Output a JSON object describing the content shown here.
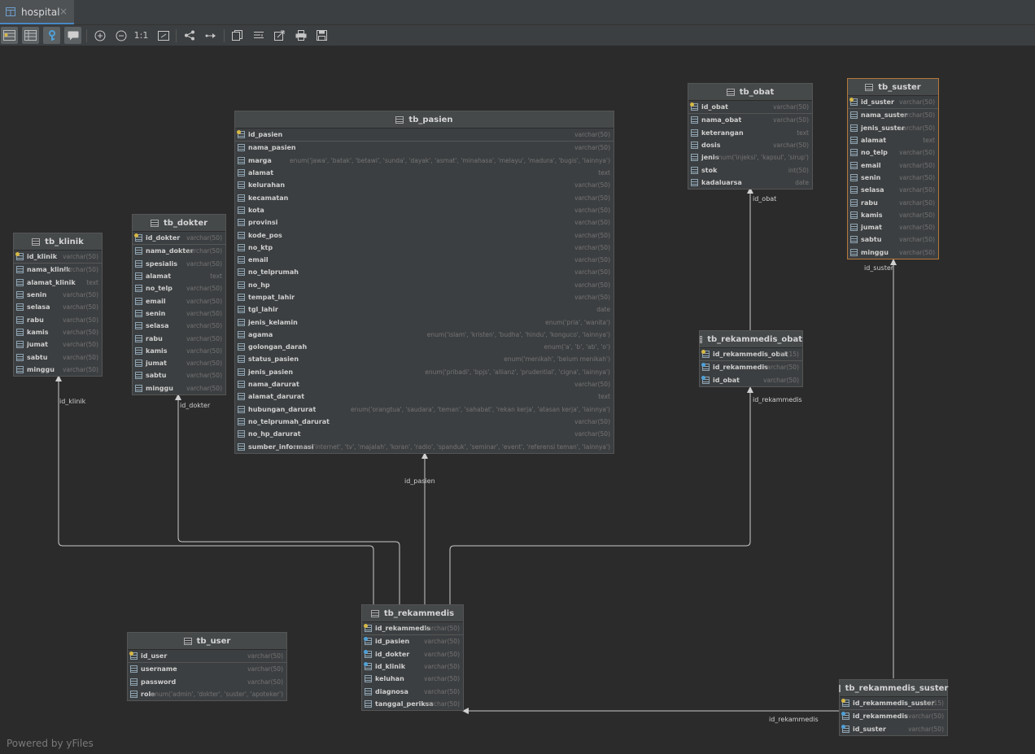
{
  "tab": {
    "title": "hospital",
    "close": "×"
  },
  "toolbar": {
    "actual_size": "1:1"
  },
  "footer": "Powered by yFiles",
  "links": {
    "id_klinik": "id_klinik",
    "id_dokter": "id_dokter",
    "id_pasien": "id_pasien",
    "id_obat": "id_obat",
    "id_suster": "id_suster",
    "id_rekammedis_1": "id_rekammedis",
    "id_rekammedis_2": "id_rekammedis"
  },
  "tables": {
    "tb_klinik": {
      "name": "tb_klinik",
      "cols": [
        {
          "n": "id_klinik",
          "t": "varchar(50)"
        },
        {
          "n": "nama_klinik",
          "t": "varchar(50)"
        },
        {
          "n": "alamat_klinik",
          "t": "text"
        },
        {
          "n": "senin",
          "t": "varchar(50)"
        },
        {
          "n": "selasa",
          "t": "varchar(50)"
        },
        {
          "n": "rabu",
          "t": "varchar(50)"
        },
        {
          "n": "kamis",
          "t": "varchar(50)"
        },
        {
          "n": "jumat",
          "t": "varchar(50)"
        },
        {
          "n": "sabtu",
          "t": "varchar(50)"
        },
        {
          "n": "minggu",
          "t": "varchar(50)"
        }
      ]
    },
    "tb_dokter": {
      "name": "tb_dokter",
      "cols": [
        {
          "n": "id_dokter",
          "t": "varchar(50)"
        },
        {
          "n": "nama_dokter",
          "t": "varchar(50)"
        },
        {
          "n": "spesialis",
          "t": "varchar(50)"
        },
        {
          "n": "alamat",
          "t": "text"
        },
        {
          "n": "no_telp",
          "t": "varchar(50)"
        },
        {
          "n": "email",
          "t": "varchar(50)"
        },
        {
          "n": "senin",
          "t": "varchar(50)"
        },
        {
          "n": "selasa",
          "t": "varchar(50)"
        },
        {
          "n": "rabu",
          "t": "varchar(50)"
        },
        {
          "n": "kamis",
          "t": "varchar(50)"
        },
        {
          "n": "jumat",
          "t": "varchar(50)"
        },
        {
          "n": "sabtu",
          "t": "varchar(50)"
        },
        {
          "n": "minggu",
          "t": "varchar(50)"
        }
      ]
    },
    "tb_pasien": {
      "name": "tb_pasien",
      "cols": [
        {
          "n": "id_pasien",
          "t": "varchar(50)"
        },
        {
          "n": "nama_pasien",
          "t": "varchar(50)"
        },
        {
          "n": "marga",
          "t": "enum('jawa', 'batak', 'betawi', 'sunda', 'dayak', 'asmat', 'minahasa', 'melayu', 'madura', 'bugis', 'lainnya')"
        },
        {
          "n": "alamat",
          "t": "text"
        },
        {
          "n": "kelurahan",
          "t": "varchar(50)"
        },
        {
          "n": "kecamatan",
          "t": "varchar(50)"
        },
        {
          "n": "kota",
          "t": "varchar(50)"
        },
        {
          "n": "provinsi",
          "t": "varchar(50)"
        },
        {
          "n": "kode_pos",
          "t": "varchar(50)"
        },
        {
          "n": "no_ktp",
          "t": "varchar(50)"
        },
        {
          "n": "email",
          "t": "varchar(50)"
        },
        {
          "n": "no_telprumah",
          "t": "varchar(50)"
        },
        {
          "n": "no_hp",
          "t": "varchar(50)"
        },
        {
          "n": "tempat_lahir",
          "t": "varchar(50)"
        },
        {
          "n": "tgl_lahir",
          "t": "date"
        },
        {
          "n": "jenis_kelamin",
          "t": "enum('pria', 'wanita')"
        },
        {
          "n": "agama",
          "t": "enum('islam', 'kristen', 'budha', 'hindu', 'konguco', 'lainnya')"
        },
        {
          "n": "golongan_darah",
          "t": "enum('a', 'b', 'ab', 'o')"
        },
        {
          "n": "status_pasien",
          "t": "enum('menikah', 'belum menikah')"
        },
        {
          "n": "jenis_pasien",
          "t": "enum('pribadi', 'bpjs', 'allianz', 'prudential', 'cigna', 'lainnya')"
        },
        {
          "n": "nama_darurat",
          "t": "varchar(50)"
        },
        {
          "n": "alamat_darurat",
          "t": "text"
        },
        {
          "n": "hubungan_darurat",
          "t": "enum('orangtua', 'saudara', 'teman', 'sahabat', 'rekan kerja', 'atasan kerja', 'lainnya')"
        },
        {
          "n": "no_telprumah_darurat",
          "t": "varchar(50)"
        },
        {
          "n": "no_hp_darurat",
          "t": "varchar(50)"
        },
        {
          "n": "sumber_informasi",
          "t": "enum('internet', 'tv', 'majalah', 'koran', 'radio', 'spanduk', 'seminar', 'event', 'referensi teman', 'lainnya')"
        }
      ]
    },
    "tb_obat": {
      "name": "tb_obat",
      "cols": [
        {
          "n": "id_obat",
          "t": "varchar(50)"
        },
        {
          "n": "nama_obat",
          "t": "varchar(50)"
        },
        {
          "n": "keterangan",
          "t": "text"
        },
        {
          "n": "dosis",
          "t": "varchar(50)"
        },
        {
          "n": "jenis",
          "t": "enum('injeksi', 'kapsul', 'sirup')"
        },
        {
          "n": "stok",
          "t": "int(50)"
        },
        {
          "n": "kadaluarsa",
          "t": "date"
        }
      ]
    },
    "tb_suster": {
      "name": "tb_suster",
      "cols": [
        {
          "n": "id_suster",
          "t": "varchar(50)"
        },
        {
          "n": "nama_suster",
          "t": "varchar(50)"
        },
        {
          "n": "jenis_suster",
          "t": "varchar(50)"
        },
        {
          "n": "alamat",
          "t": "text"
        },
        {
          "n": "no_telp",
          "t": "varchar(50)"
        },
        {
          "n": "email",
          "t": "varchar(50)"
        },
        {
          "n": "senin",
          "t": "varchar(50)"
        },
        {
          "n": "selasa",
          "t": "varchar(50)"
        },
        {
          "n": "rabu",
          "t": "varchar(50)"
        },
        {
          "n": "kamis",
          "t": "varchar(50)"
        },
        {
          "n": "jumat",
          "t": "varchar(50)"
        },
        {
          "n": "sabtu",
          "t": "varchar(50)"
        },
        {
          "n": "minggu",
          "t": "varchar(50)"
        }
      ]
    },
    "tb_rekammedis_obat": {
      "name": "tb_rekammedis_obat",
      "cols": [
        {
          "n": "id_rekammedis_obat",
          "t": "int(15)"
        },
        {
          "n": "id_rekammedis",
          "t": "varchar(50)"
        },
        {
          "n": "id_obat",
          "t": "varchar(50)"
        }
      ]
    },
    "tb_rekammedis": {
      "name": "tb_rekammedis",
      "cols": [
        {
          "n": "id_rekammedis",
          "t": "varchar(50)"
        },
        {
          "n": "id_pasien",
          "t": "varchar(50)"
        },
        {
          "n": "id_dokter",
          "t": "varchar(50)"
        },
        {
          "n": "id_klinik",
          "t": "varchar(50)"
        },
        {
          "n": "keluhan",
          "t": "varchar(50)"
        },
        {
          "n": "diagnosa",
          "t": "varchar(50)"
        },
        {
          "n": "tanggal_periksa",
          "t": "varchar(50)"
        }
      ]
    },
    "tb_user": {
      "name": "tb_user",
      "cols": [
        {
          "n": "id_user",
          "t": "varchar(50)"
        },
        {
          "n": "username",
          "t": "varchar(50)"
        },
        {
          "n": "password",
          "t": "varchar(50)"
        },
        {
          "n": "role",
          "t": "enum('admin', 'dokter', 'suster', 'apoteker')"
        }
      ]
    },
    "tb_rekammedis_suster": {
      "name": "tb_rekammedis_suster",
      "cols": [
        {
          "n": "id_rekammedis_suster",
          "t": "int(15)"
        },
        {
          "n": "id_rekammedis",
          "t": "varchar(50)"
        },
        {
          "n": "id_suster",
          "t": "varchar(50)"
        }
      ]
    }
  }
}
